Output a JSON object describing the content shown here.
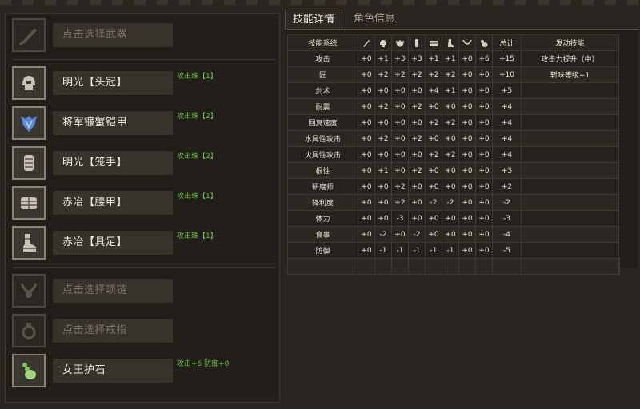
{
  "tabs": [
    {
      "label": "技能详情",
      "active": true
    },
    {
      "label": "角色信息",
      "active": false
    }
  ],
  "equipment": [
    {
      "slot": "weapon",
      "icon": "weapon-icon",
      "label": "点击选择武器",
      "empty": true,
      "note": ""
    },
    {
      "slot": "helm",
      "icon": "helmet-icon",
      "label": "明光【头冠】",
      "empty": false,
      "note": "攻击珠【1】"
    },
    {
      "slot": "chest",
      "icon": "chest-armor-icon",
      "label": "将军镰蟹铠甲",
      "empty": false,
      "note": "攻击珠【2】"
    },
    {
      "slot": "arms",
      "icon": "gauntlet-icon",
      "label": "明光【笼手】",
      "empty": false,
      "note": "攻击珠【2】"
    },
    {
      "slot": "waist",
      "icon": "waist-armor-icon",
      "label": "赤冶【腰甲】",
      "empty": false,
      "note": "攻击珠【1】"
    },
    {
      "slot": "legs",
      "icon": "leg-armor-icon",
      "label": "赤冶【具足】",
      "empty": false,
      "note": "攻击珠【1】"
    },
    {
      "slot": "necklace",
      "icon": "necklace-icon",
      "label": "点击选择项链",
      "empty": true,
      "note": ""
    },
    {
      "slot": "ring",
      "icon": "ring-icon",
      "label": "点击选择戒指",
      "empty": true,
      "note": ""
    },
    {
      "slot": "charm",
      "icon": "charm-stone-icon",
      "label": "女王护石",
      "empty": false,
      "note": "攻击+6 防御+0"
    }
  ],
  "skill_table": {
    "header_name": "技能系统",
    "header_total": "总计",
    "header_active": "发动技能",
    "column_icons": [
      "weapon-icon",
      "helmet-icon",
      "chest-armor-icon",
      "gauntlet-icon",
      "waist-armor-icon",
      "leg-armor-icon",
      "necklace-icon",
      "charm-stone-icon"
    ],
    "rows": [
      {
        "name": "攻击",
        "vals": [
          "+0",
          "+1",
          "+3",
          "+3",
          "+1",
          "+1",
          "+0",
          "+6"
        ],
        "total": "+15",
        "active": "攻击力提升（中）"
      },
      {
        "name": "匠",
        "vals": [
          "+0",
          "+2",
          "+2",
          "+2",
          "+2",
          "+2",
          "+0",
          "+0"
        ],
        "total": "+10",
        "active": "斩味等级+1"
      },
      {
        "name": "剑术",
        "vals": [
          "+0",
          "+0",
          "+0",
          "+0",
          "+4",
          "+1",
          "+0",
          "+0"
        ],
        "total": "+5",
        "active": ""
      },
      {
        "name": "耐震",
        "vals": [
          "+0",
          "+2",
          "+0",
          "+2",
          "+0",
          "+0",
          "+0",
          "+0"
        ],
        "total": "+4",
        "active": ""
      },
      {
        "name": "回复速度",
        "vals": [
          "+0",
          "+0",
          "+0",
          "+0",
          "+2",
          "+2",
          "+0",
          "+0"
        ],
        "total": "+4",
        "active": ""
      },
      {
        "name": "水属性攻击",
        "vals": [
          "+0",
          "+2",
          "+0",
          "+2",
          "+0",
          "+0",
          "+0",
          "+0"
        ],
        "total": "+4",
        "active": ""
      },
      {
        "name": "火属性攻击",
        "vals": [
          "+0",
          "+0",
          "+0",
          "+0",
          "+2",
          "+2",
          "+0",
          "+0"
        ],
        "total": "+4",
        "active": ""
      },
      {
        "name": "根性",
        "vals": [
          "+0",
          "+1",
          "+0",
          "+2",
          "+0",
          "+0",
          "+0",
          "+0"
        ],
        "total": "+3",
        "active": ""
      },
      {
        "name": "研磨师",
        "vals": [
          "+0",
          "+0",
          "+2",
          "+0",
          "+0",
          "+0",
          "+0",
          "+0"
        ],
        "total": "+2",
        "active": ""
      },
      {
        "name": "锋利度",
        "vals": [
          "+0",
          "+0",
          "+2",
          "+0",
          "-2",
          "-2",
          "+0",
          "+0"
        ],
        "total": "-2",
        "active": ""
      },
      {
        "name": "体力",
        "vals": [
          "+0",
          "+0",
          "-3",
          "+0",
          "+0",
          "+0",
          "+0",
          "+0"
        ],
        "total": "-3",
        "active": ""
      },
      {
        "name": "食事",
        "vals": [
          "+0",
          "-2",
          "+0",
          "-2",
          "+0",
          "+0",
          "+0",
          "+0"
        ],
        "total": "-4",
        "active": ""
      },
      {
        "name": "防御",
        "vals": [
          "+0",
          "-1",
          "-1",
          "-1",
          "-1",
          "-1",
          "+0",
          "+0"
        ],
        "total": "-5",
        "active": ""
      }
    ]
  }
}
